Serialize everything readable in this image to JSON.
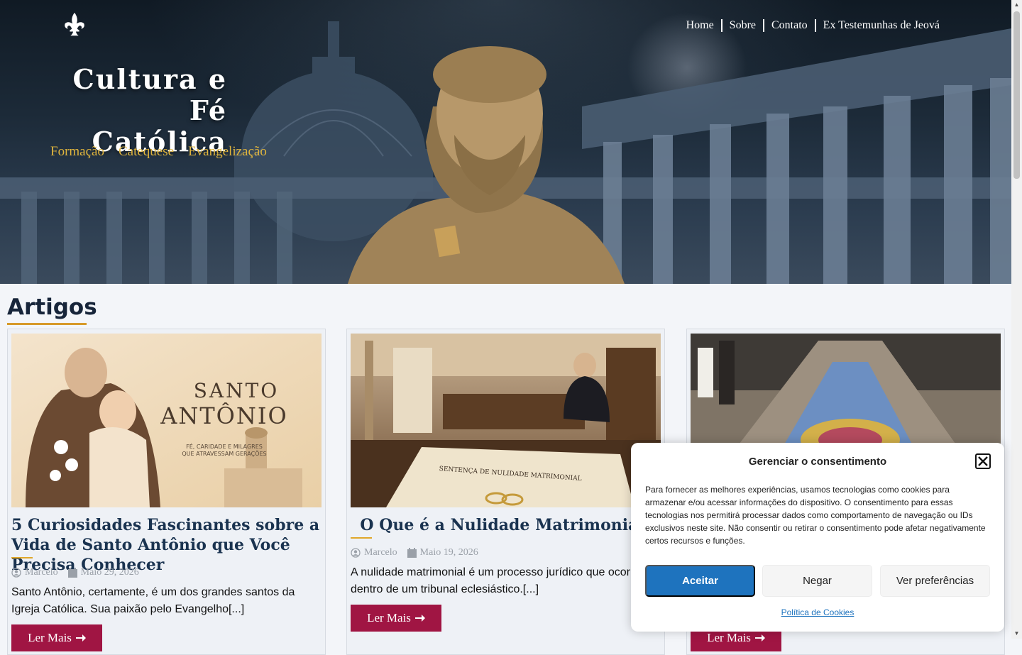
{
  "site": {
    "title": "Cultura e Fé Católica",
    "title_line1": "Cultura e Fé",
    "title_line2": "Católica"
  },
  "top_nav": [
    "Home",
    "Sobre",
    "Contato",
    "Ex Testemunhas de Jeová"
  ],
  "category_nav": [
    "Formação",
    "Catequese",
    "Evangelização"
  ],
  "section": {
    "title": "Artigos"
  },
  "articles": [
    {
      "title": "5 Curiosidades Fascinantes sobre a Vida de Santo Antônio que Você Precisa Conhecer",
      "author": "Marcelo",
      "date": "Maio 29, 2026",
      "excerpt": "Santo Antônio, certamente, é um dos grandes santos da Igreja Católica. Sua paixão pelo Evangelho[...]",
      "button": "Ler Mais",
      "image_text": {
        "line1": "SANTO",
        "line2": "ANTÔNIO",
        "tagline1": "FÉ, CARIDADE E MILAGRES",
        "tagline2": "QUE ATRAVESSAM GERAÇÕES"
      }
    },
    {
      "title": "O Que é a Nulidade Matrimonial?",
      "author": "Marcelo",
      "date": "Maio 19, 2026",
      "excerpt": "A nulidade matrimonial é um processo jurídico que ocorre dentro de um tribunal eclesiástico.[...]",
      "button": "Ler Mais",
      "image_text": {
        "doc": "SENTENÇA DE NULIDADE MATRIMONIAL"
      }
    },
    {
      "title": "",
      "button": "Ler Mais"
    }
  ],
  "cookie": {
    "title": "Gerenciar o consentimento",
    "text": "Para fornecer as melhores experiências, usamos tecnologias como cookies para armazenar e/ou acessar informações do dispositivo. O consentimento para essas tecnologias nos permitirá processar dados como comportamento de navegação ou IDs exclusivos neste site. Não consentir ou retirar o consentimento pode afetar negativamente certos recursos e funções.",
    "accept": "Aceitar",
    "deny": "Negar",
    "preferences": "Ver preferências",
    "policy": "Política de Cookies"
  },
  "colors": {
    "accent_gold": "#e0b53d",
    "button_red": "#a01543",
    "title_navy": "#1a3350",
    "accept_blue": "#1e73be"
  },
  "icons": [
    "fleur-de-lis-icon",
    "user-icon",
    "calendar-icon",
    "arrow-right-icon",
    "close-icon"
  ]
}
